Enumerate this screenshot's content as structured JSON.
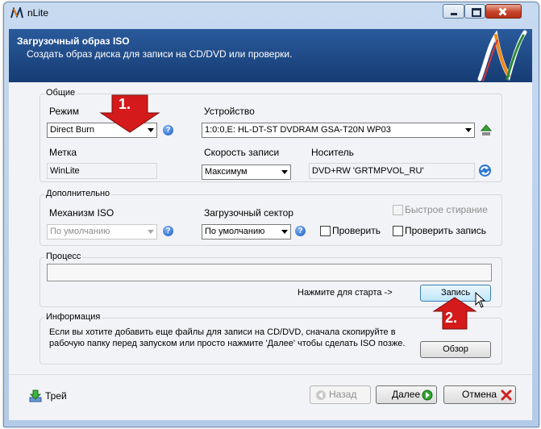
{
  "window": {
    "title": "nLite"
  },
  "header": {
    "title": "Загрузочный образ ISO",
    "subtitle": "Создать образ диска для записи на CD/DVD или проверки."
  },
  "general": {
    "group_title": "Общие",
    "mode_label": "Режим",
    "mode_value": "Direct Burn",
    "device_label": "Устройство",
    "device_value": "1:0:0,E: HL-DT-ST DVDRAM GSA-T20N  WP03",
    "label_label": "Метка",
    "label_value": "WinLite",
    "speed_label": "Скорость записи",
    "speed_value": "Максимум",
    "media_label": "Носитель",
    "media_value": "DVD+RW 'GRTMPVOL_RU'"
  },
  "advanced": {
    "group_title": "Дополнительно",
    "iso_engine_label": "Механизм ISO",
    "iso_engine_value": "По умолчанию",
    "boot_sector_label": "Загрузочный сектор",
    "boot_sector_value": "По умолчанию",
    "quick_erase_label": "Быстрое стирание",
    "verify_label": "Проверить",
    "verify_burn_label": "Проверить запись"
  },
  "process": {
    "group_title": "Процесс",
    "hint": "Нажмите для старта ->",
    "burn_button": "Запись"
  },
  "info": {
    "group_title": "Информация",
    "text_line1": "Если вы хотите добавить еще файлы для записи на CD/DVD, сначала скопируйте в",
    "text_line2": "рабочую папку перед запуском или просто нажмите 'Далее' чтобы сделать ISO позже.",
    "browse_button": "Обзор"
  },
  "footer": {
    "tray_label": "Трей",
    "back_label": "Назад",
    "next_label": "Далее",
    "cancel_label": "Отмена"
  },
  "annotations": {
    "marker1": "1.",
    "marker2": "2."
  },
  "colors": {
    "banner": "#1f4c8c",
    "marker": "#d41a1a",
    "accent_blue": "#1d5ec7"
  }
}
